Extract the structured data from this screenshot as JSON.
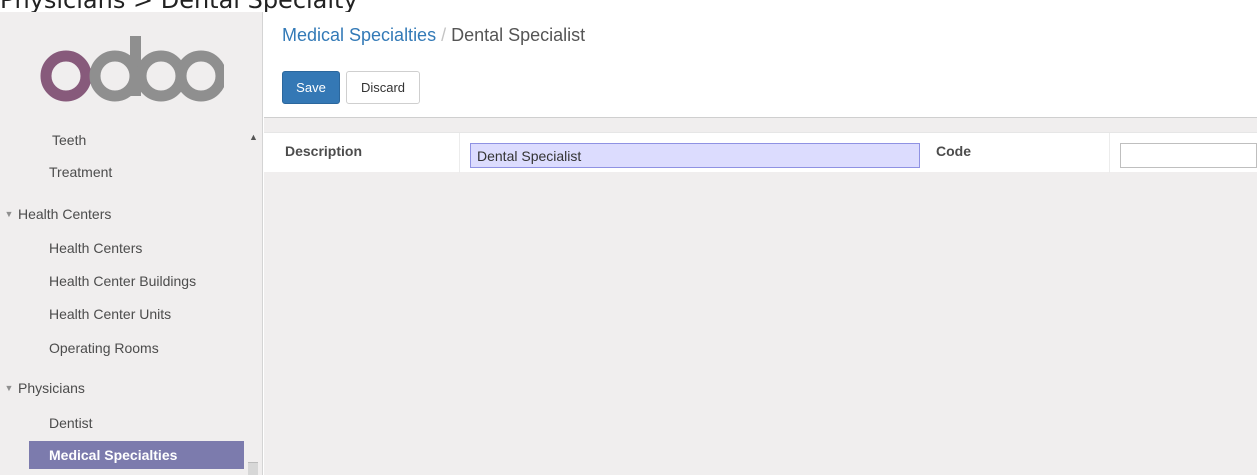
{
  "top_caption": "Physicians > Dental Specialty",
  "logo": {
    "text": "odoo",
    "colors": {
      "o1": "#875a7b",
      "d": "#8f8f8f",
      "o2": "#8f8f8f",
      "o3": "#8f8f8f"
    }
  },
  "sidebar": {
    "items": [
      {
        "label": "Teeth"
      },
      {
        "label": "Treatment"
      }
    ],
    "sections": [
      {
        "label": "Health Centers",
        "items": [
          "Health Centers",
          "Health Center Buildings",
          "Health Center Units",
          "Operating Rooms"
        ]
      },
      {
        "label": "Physicians",
        "items": [
          "Dentist",
          "Medical Specialties"
        ]
      }
    ],
    "active_item": "Medical Specialties",
    "active_color": "#7c7bad"
  },
  "breadcrumb": {
    "parent": "Medical Specialties",
    "separator": "/",
    "current": "Dental Specialist"
  },
  "buttons": {
    "save": "Save",
    "discard": "Discard"
  },
  "form": {
    "description_label": "Description",
    "description_value": "Dental Specialist",
    "code_label": "Code",
    "code_value": ""
  },
  "colors": {
    "primary": "#3478b5",
    "link": "#337ab7"
  }
}
